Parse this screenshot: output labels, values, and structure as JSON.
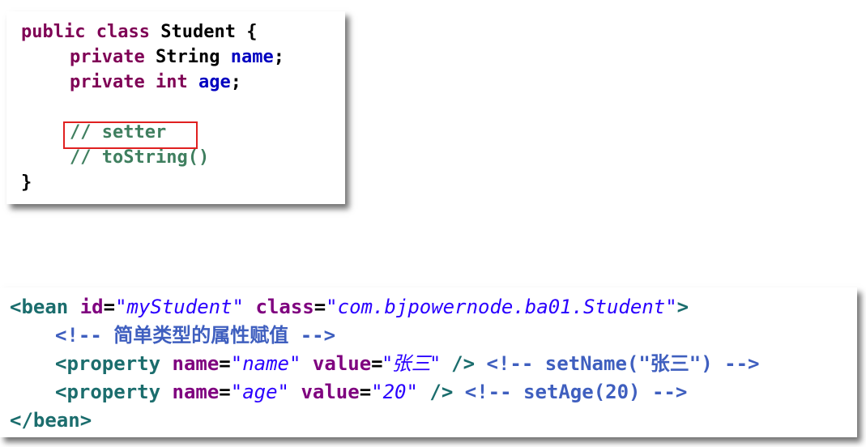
{
  "java_code": {
    "line1": {
      "kw_public": "public",
      "kw_class": "class",
      "class_name": "Student",
      "brace": "{"
    },
    "line2": {
      "kw_private": "private",
      "type": "String",
      "field": "name",
      "semicolon": ";"
    },
    "line3": {
      "kw_private": "private",
      "type": "int",
      "field": "age",
      "semicolon": ";"
    },
    "line5": {
      "comment": "// setter"
    },
    "line6": {
      "comment": "// toString()"
    },
    "line7": {
      "brace": "}"
    }
  },
  "xml_code": {
    "line1": {
      "tag_open": "<bean",
      "id_attr": "id",
      "eq1": "=",
      "id_value": "\"myStudent\"",
      "class_attr": "class",
      "eq2": "=",
      "class_value": "\"com.bjpowernode.ba01.Student\"",
      "tag_close": ">"
    },
    "line2": {
      "comment": "<!-- 简单类型的属性赋值 -->"
    },
    "line3": {
      "tag_open": "<property",
      "name_attr": "name",
      "eq1": "=",
      "name_value": "\"name\"",
      "value_attr": "value",
      "eq2": "=",
      "value_value": "\"张三\"",
      "tag_close": "/>",
      "comment": "<!-- setName(\"张三\") -->"
    },
    "line4": {
      "tag_open": "<property",
      "name_attr": "name",
      "eq1": "=",
      "name_value": "\"age\"",
      "value_attr": "value",
      "eq2": "=",
      "value_value": "\"20\"",
      "tag_close": "/>",
      "comment": "<!-- setAge(20) -->"
    },
    "line5": {
      "tag_end": "</bean>"
    }
  },
  "colors": {
    "keyword": "#7f0055",
    "field": "#0000c0",
    "java_comment": "#3f7f5f",
    "highlight_box": "#e02020",
    "xml_tag": "#1b6d6d",
    "xml_attr": "#7f007f",
    "xml_value": "#2a00ff",
    "xml_comment": "#3f5fbf"
  }
}
